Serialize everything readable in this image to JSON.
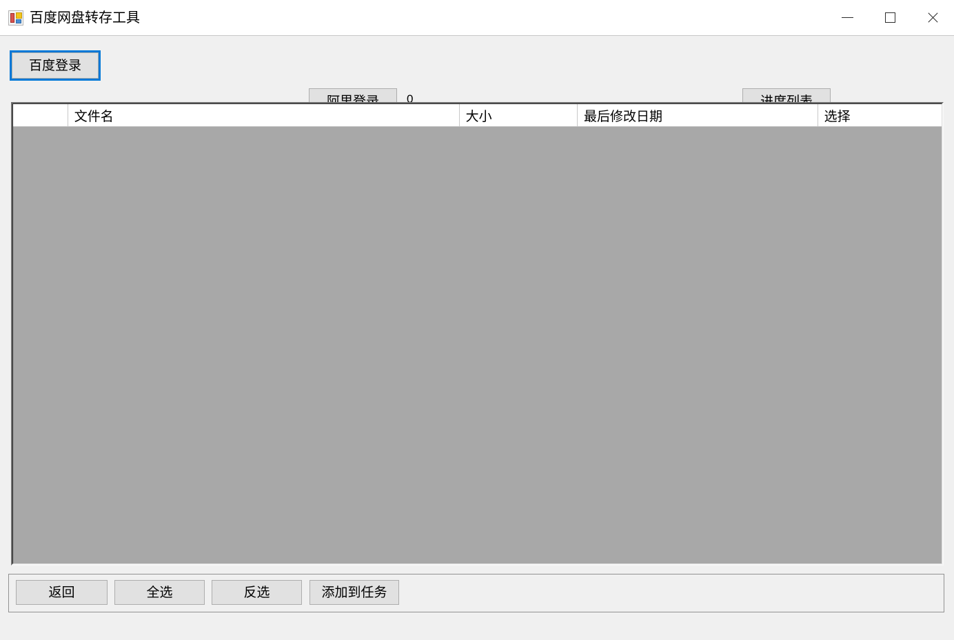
{
  "window": {
    "title": "百度网盘转存工具",
    "icon": "winforms-app-icon",
    "controls": {
      "minimize": "minimize-icon",
      "maximize": "maximize-icon",
      "close": "close-icon"
    }
  },
  "toolbar": {
    "baidu_login_label": "百度登录",
    "ali_login_label": "阿里登录",
    "count_label": "0",
    "progress_list_label": "进度列表"
  },
  "listview": {
    "columns": [
      {
        "label": ""
      },
      {
        "label": "文件名"
      },
      {
        "label": "大小"
      },
      {
        "label": "最后修改日期"
      },
      {
        "label": "选择"
      }
    ],
    "rows": []
  },
  "bottom_bar": {
    "back_label": "返回",
    "select_all_label": "全选",
    "invert_label": "反选",
    "add_task_label": "添加到任务"
  },
  "colors": {
    "window_background": "#f0f0f0",
    "titlebar_background": "#ffffff",
    "button_face": "#e1e1e1",
    "button_border": "#adadad",
    "focus_accent": "#0078d7",
    "list_empty_background": "#a8a8a8",
    "header_background": "#ffffff"
  }
}
